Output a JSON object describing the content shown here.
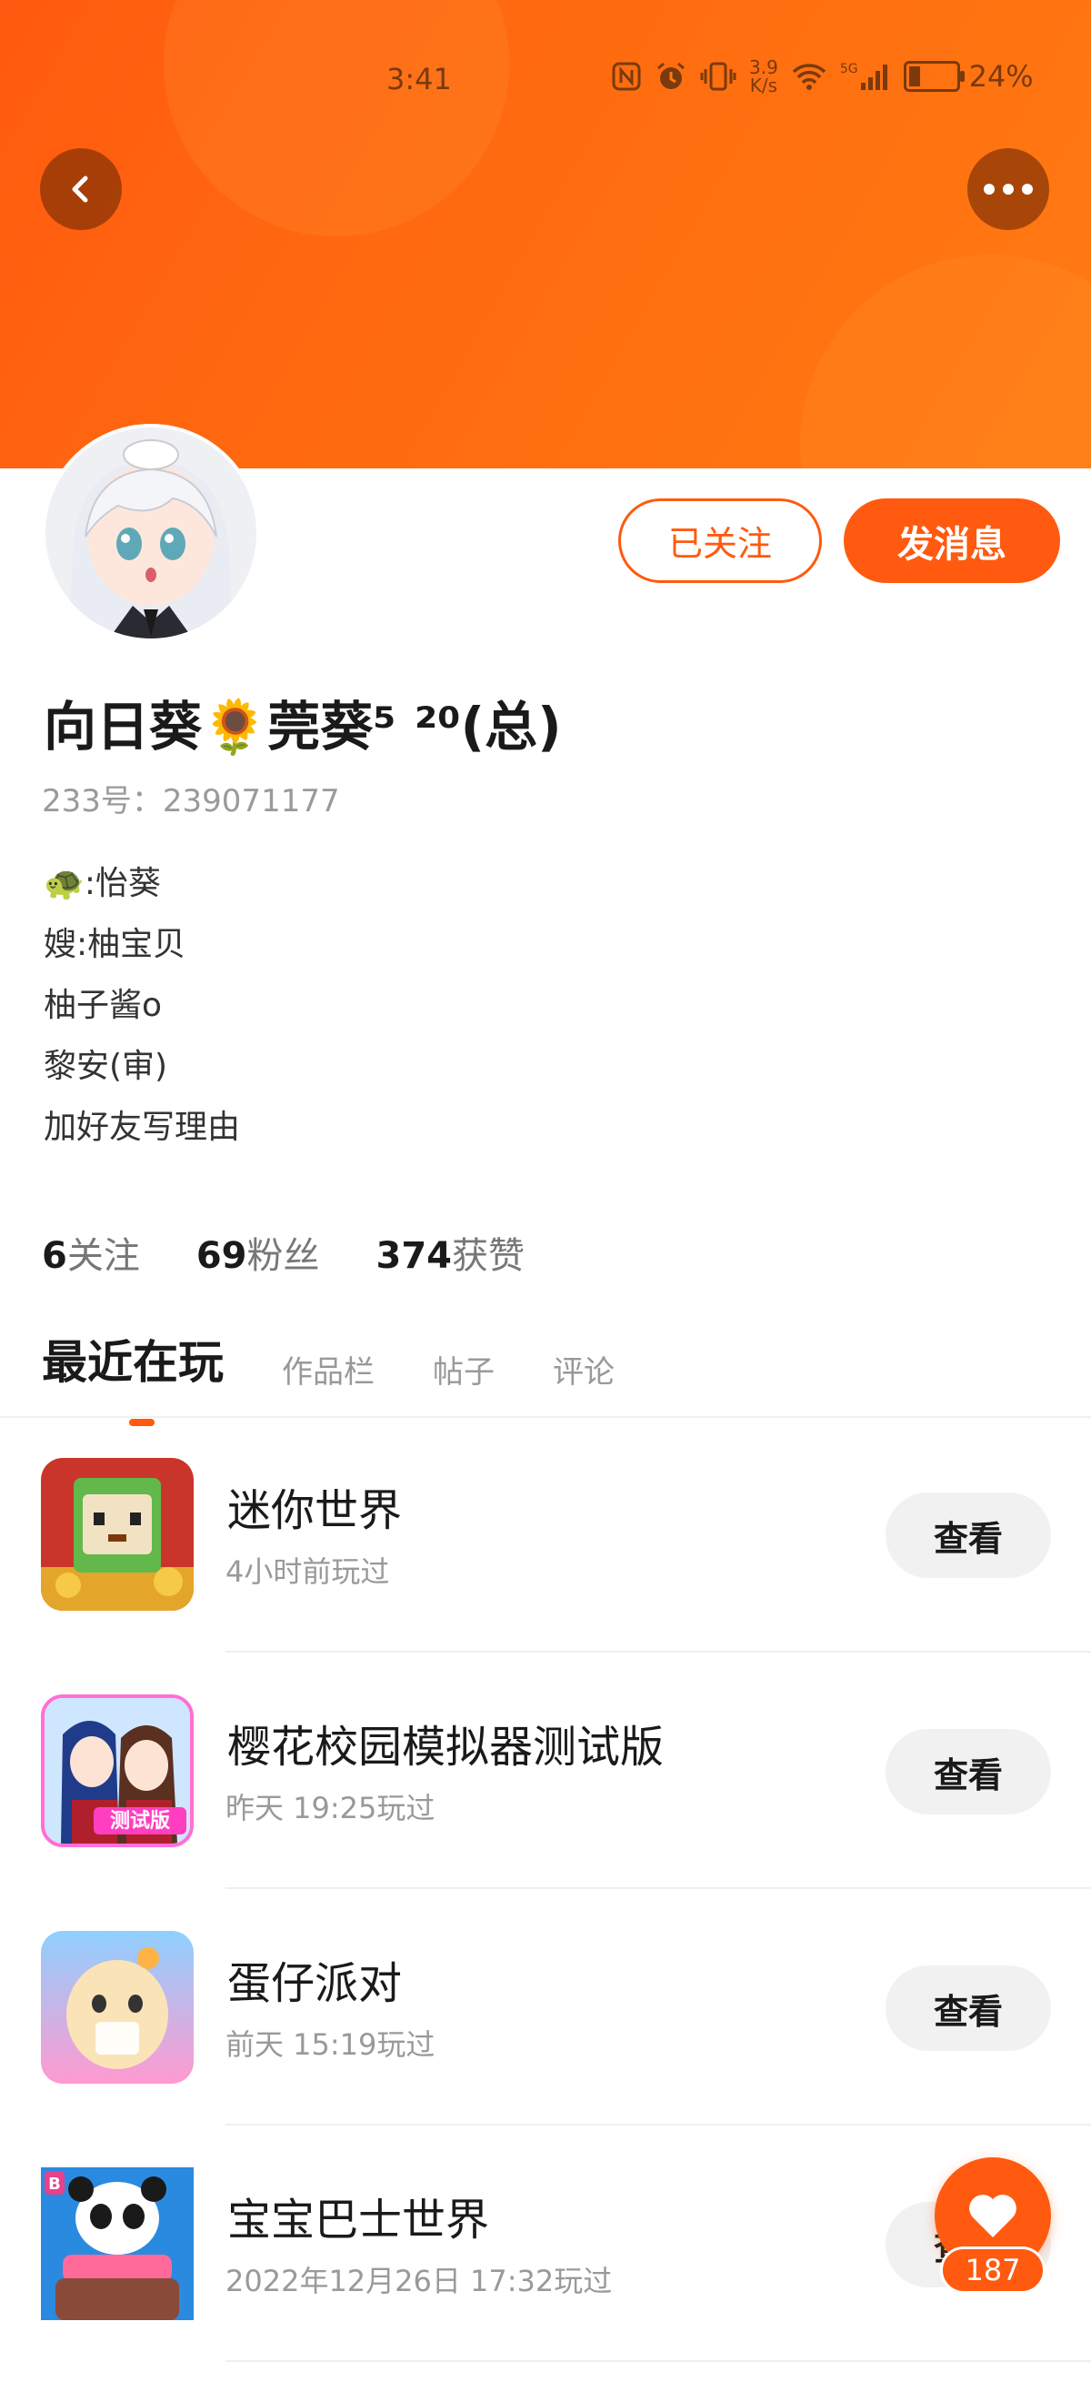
{
  "status_bar": {
    "time": "3:41",
    "net_speed_value": "3.9",
    "net_speed_unit": "K/s",
    "network_label": "5G",
    "battery_percent": "24%",
    "battery_level": 0.24
  },
  "profile": {
    "nickname": "向日葵🌻莞葵⁵ ²⁰(总)",
    "uid_label": "233号：",
    "uid": "239071177",
    "bio": [
      "🐢:怡葵",
      "嫂:柚宝贝",
      "柚子酱o",
      "黎安(审)",
      "加好友写理由"
    ],
    "follow_button": "已关注",
    "message_button": "发消息"
  },
  "stats": [
    {
      "value": "6",
      "label": "关注"
    },
    {
      "value": "69",
      "label": "粉丝"
    },
    {
      "value": "374",
      "label": "获赞"
    }
  ],
  "tabs": [
    "最近在玩",
    "作品栏",
    "帖子",
    "评论"
  ],
  "games": [
    {
      "title": "迷你世界",
      "played": "4小时前玩过",
      "button": "查看"
    },
    {
      "title": "樱花校园模拟器测试版",
      "played": "昨天  19:25玩过",
      "button": "查看"
    },
    {
      "title": "蛋仔派对",
      "played": "前天  15:19玩过",
      "button": "查看"
    },
    {
      "title": "宝宝巴士世界",
      "played": "2022年12月26日  17:32玩过",
      "button": "查看"
    }
  ],
  "game_icon_texts": {
    "sakura_badge": "测试版",
    "babybus_badge": "B"
  },
  "like": {
    "count": "187"
  },
  "colors": {
    "accent": "#ff5a0f",
    "header": "#ff6a10"
  }
}
